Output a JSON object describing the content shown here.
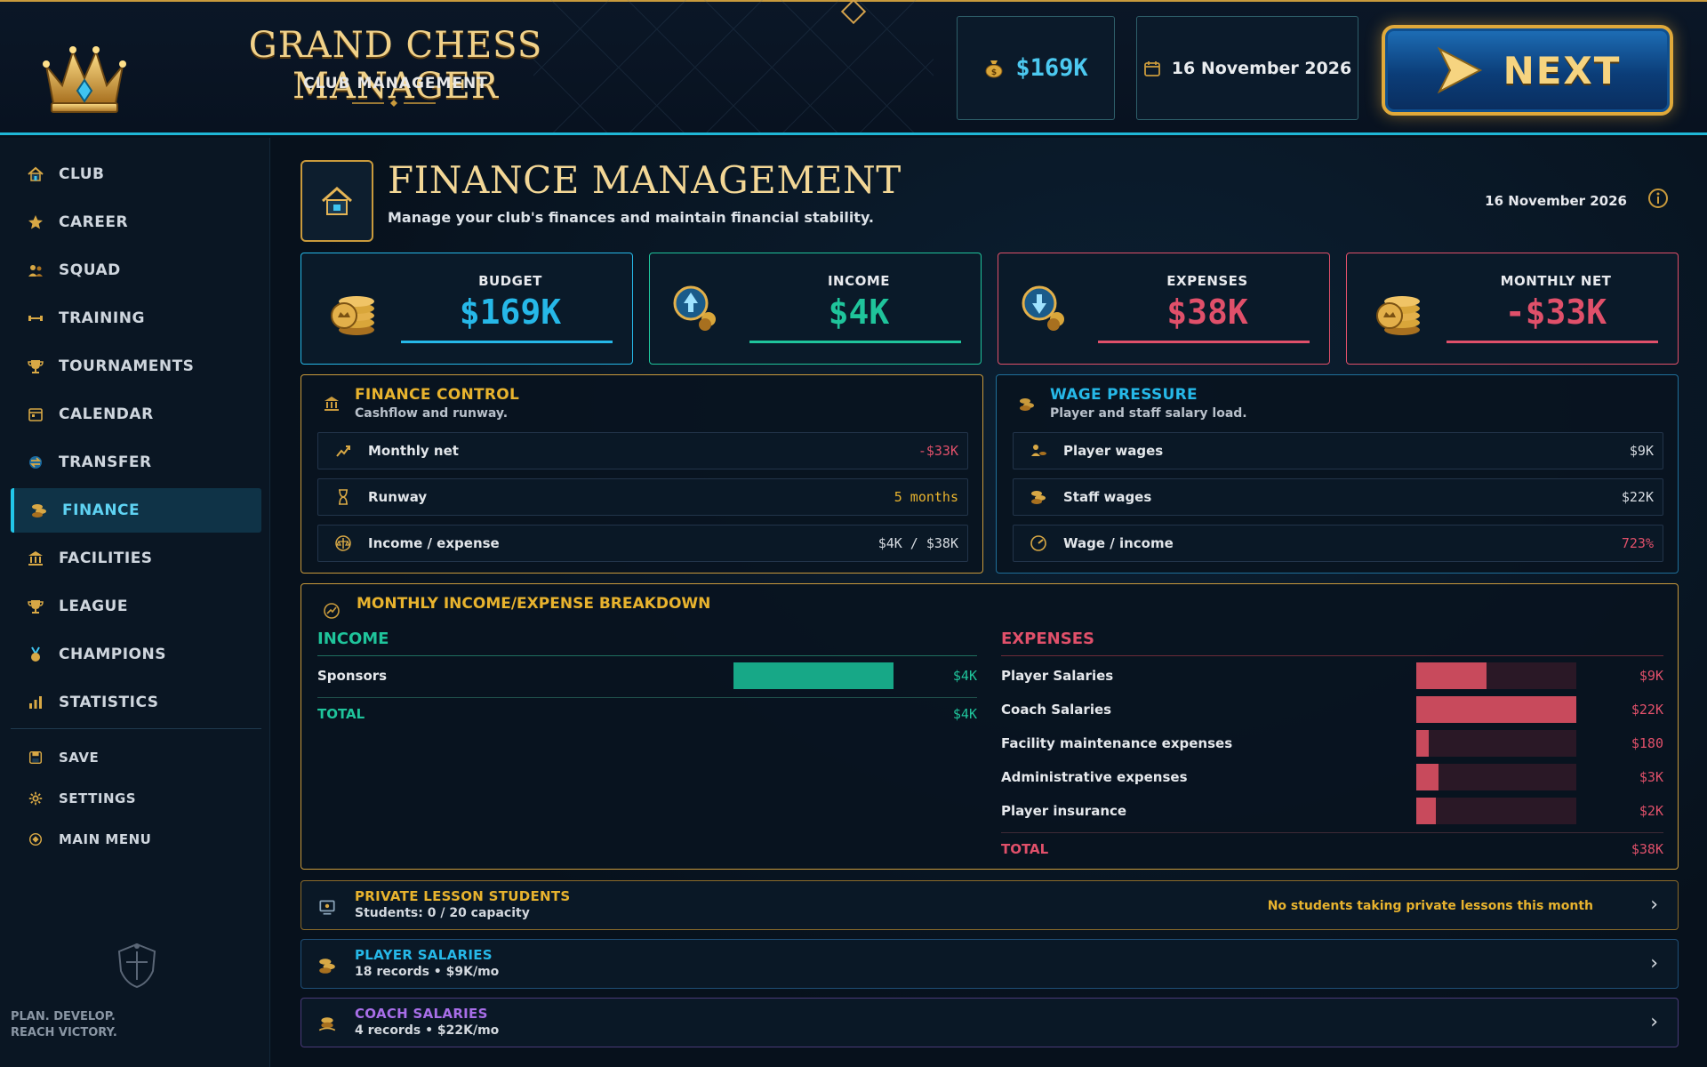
{
  "header": {
    "title": "GRAND CHESS MANAGER",
    "subtitle": "CLUB MANAGEMENT",
    "money": "$169K",
    "date": "16 November 2026",
    "next_label": "NEXT"
  },
  "sidebar": {
    "items": [
      {
        "label": "CLUB",
        "icon": "house-icon"
      },
      {
        "label": "CAREER",
        "icon": "star-icon"
      },
      {
        "label": "SQUAD",
        "icon": "users-icon"
      },
      {
        "label": "TRAINING",
        "icon": "dumbbell-icon"
      },
      {
        "label": "TOURNAMENTS",
        "icon": "trophy-icon"
      },
      {
        "label": "CALENDAR",
        "icon": "calendar-icon"
      },
      {
        "label": "TRANSFER",
        "icon": "transfer-icon"
      },
      {
        "label": "FINANCE",
        "icon": "coins-icon",
        "active": true
      },
      {
        "label": "FACILITIES",
        "icon": "building-icon"
      },
      {
        "label": "LEAGUE",
        "icon": "trophy-icon"
      },
      {
        "label": "CHAMPIONS",
        "icon": "medal-icon"
      },
      {
        "label": "STATISTICS",
        "icon": "bar-chart-icon"
      }
    ],
    "secondary": [
      {
        "label": "SAVE",
        "icon": "save-icon"
      },
      {
        "label": "SETTINGS",
        "icon": "gear-icon"
      },
      {
        "label": "MAIN MENU",
        "icon": "menu-icon"
      }
    ],
    "tagline_1": "PLAN. DEVELOP.",
    "tagline_2": "REACH VICTORY."
  },
  "page": {
    "title": "FINANCE MANAGEMENT",
    "subtitle": "Manage your club's finances and maintain financial stability.",
    "date": "16 November 2026"
  },
  "stats": [
    {
      "label": "BUDGET",
      "value": "$169K",
      "color": "#26b8e8"
    },
    {
      "label": "INCOME",
      "value": "$4K",
      "color": "#1fc49b"
    },
    {
      "label": "EXPENSES",
      "value": "$38K",
      "color": "#e0506a"
    },
    {
      "label": "MONTHLY NET",
      "value": "-$33K",
      "color": "#e0506a"
    }
  ],
  "finance_control": {
    "title": "FINANCE CONTROL",
    "subtitle": "Cashflow and runway.",
    "rows": [
      {
        "label": "Monthly net",
        "value": "-$33K"
      },
      {
        "label": "Runway",
        "value": "5 months"
      },
      {
        "label": "Income / expense",
        "value": "$4K / $38K"
      }
    ]
  },
  "wage_pressure": {
    "title": "WAGE PRESSURE",
    "subtitle": "Player and staff salary load.",
    "rows": [
      {
        "label": "Player wages",
        "value": "$9K"
      },
      {
        "label": "Staff wages",
        "value": "$22K"
      },
      {
        "label": "Wage / income",
        "value": "723%"
      }
    ]
  },
  "breakdown": {
    "title": "MONTHLY INCOME/EXPENSE BREAKDOWN",
    "income_header": "INCOME",
    "income_rows": [
      {
        "label": "Sponsors",
        "value": "$4K",
        "fill": 1.0
      }
    ],
    "income_total_label": "TOTAL",
    "income_total": "$4K",
    "expenses_header": "EXPENSES",
    "expense_rows": [
      {
        "label": "Player Salaries",
        "value": "$9K",
        "fill": 0.44
      },
      {
        "label": "Coach Salaries",
        "value": "$22K",
        "fill": 1.0
      },
      {
        "label": "Facility maintenance expenses",
        "value": "$180",
        "fill": 0.08
      },
      {
        "label": "Administrative expenses",
        "value": "$3K",
        "fill": 0.14
      },
      {
        "label": "Player insurance",
        "value": "$2K",
        "fill": 0.12
      }
    ],
    "expenses_total_label": "TOTAL",
    "expenses_total": "$38K"
  },
  "collapsibles": [
    {
      "title": "PRIVATE LESSON STUDENTS",
      "subtitle": "Students: 0 / 20 capacity",
      "note": "No students taking private lessons this month",
      "color": "#e8b32e"
    },
    {
      "title": "PLAYER SALARIES",
      "subtitle": "18 records  •  $9K/mo",
      "note": "",
      "color": "#26b8e8"
    },
    {
      "title": "COACH SALARIES",
      "subtitle": "4 records  •  $22K/mo",
      "note": "",
      "color": "#a86ee8"
    }
  ],
  "colors": {
    "accent_cyan": "#1fb7d6",
    "gold": "#c99a3c",
    "income_green": "#1fb08a",
    "expense_red": "#d44d62"
  }
}
